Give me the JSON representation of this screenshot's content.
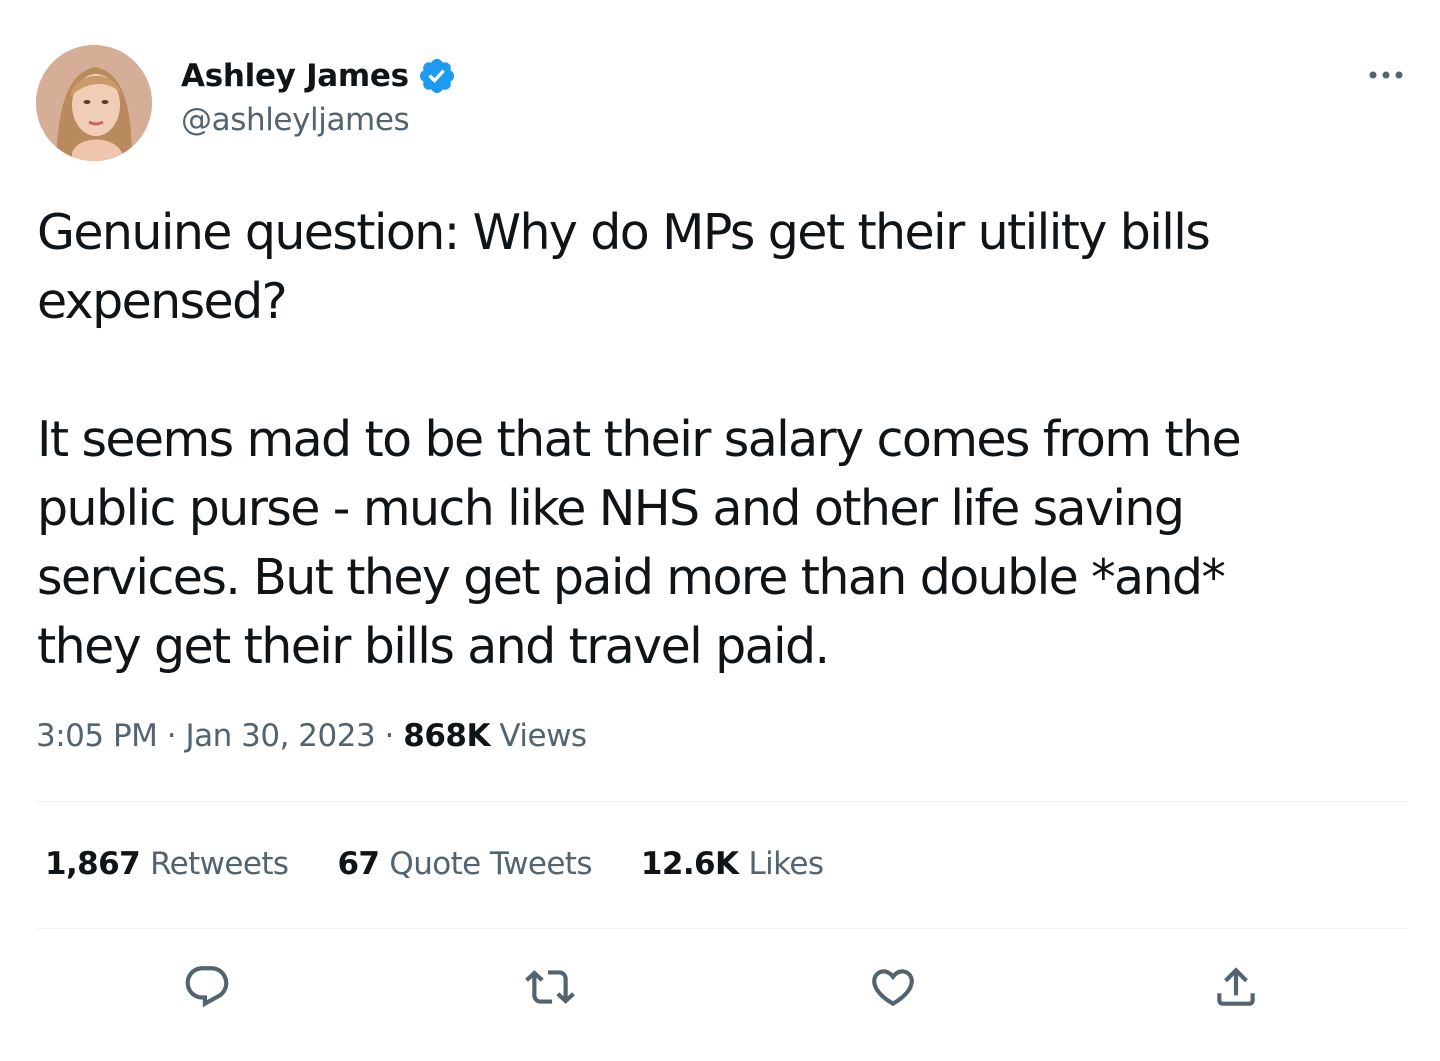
{
  "author": {
    "display_name": "Ashley James",
    "handle": "@ashleyljames",
    "verified_icon": "verified-badge-icon"
  },
  "tweet": {
    "paragraphs": [
      "Genuine question: Why do MPs get their utility bills\nexpensed?",
      "It seems mad to be that their salary comes from the\npublic purse - much like NHS and other life saving\nservices. But they get paid more than double *and*\nthey get their bills and travel paid."
    ]
  },
  "meta": {
    "time": "3:05 PM",
    "separator": "·",
    "date": "Jan 30, 2023",
    "views_count": "868K",
    "views_label": "Views"
  },
  "stats": {
    "retweets_count": "1,867",
    "retweets_label": "Retweets",
    "quotes_count": "67",
    "quotes_label": "Quote Tweets",
    "likes_count": "12.6K",
    "likes_label": "Likes"
  },
  "actions": [
    "reply-icon",
    "retweet-icon",
    "like-icon",
    "share-icon"
  ],
  "colors": {
    "text_primary": "#0f1419",
    "text_secondary": "#536471",
    "verified_blue": "#1d9bf0",
    "divider": "#eff3f4"
  }
}
